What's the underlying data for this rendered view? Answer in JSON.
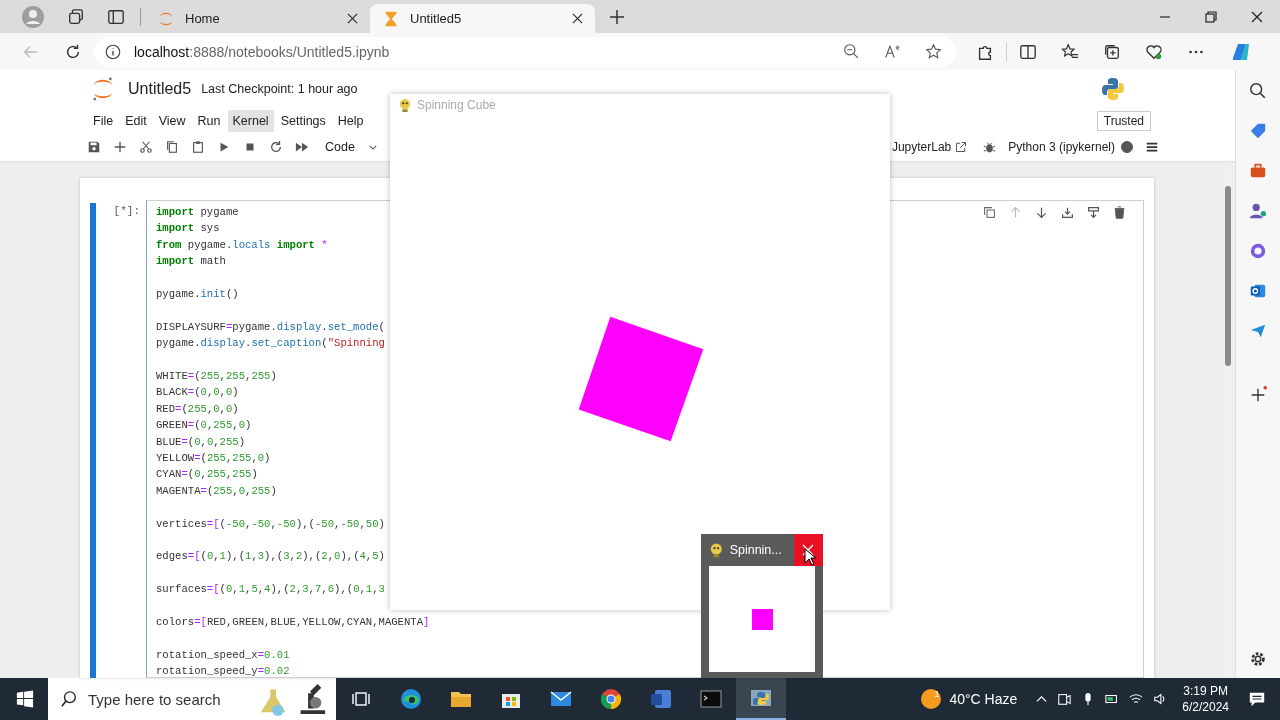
{
  "browser": {
    "tabs": [
      {
        "label": "Home",
        "kind": "jupyter",
        "selected": false
      },
      {
        "label": "Untitled5",
        "kind": "hourglass",
        "selected": true
      }
    ],
    "url_host": "localhost",
    "url_path": ":8888/notebooks/Untitled5.ipynb"
  },
  "notebook": {
    "title": "Untitled5",
    "checkpoint": "Last Checkpoint: 1 hour ago",
    "trusted": "Trusted",
    "menu": [
      {
        "label": "File",
        "selected": false
      },
      {
        "label": "Edit",
        "selected": false
      },
      {
        "label": "View",
        "selected": false
      },
      {
        "label": "Run",
        "selected": false
      },
      {
        "label": "Kernel",
        "selected": true
      },
      {
        "label": "Settings",
        "selected": false
      },
      {
        "label": "Help",
        "selected": false
      }
    ],
    "cell_type": "Code",
    "jupyterlab": "JupyterLab",
    "kernel": "Python 3 (ipykernel)",
    "kernel_busy": true,
    "cell": {
      "prompt": "[*]:",
      "selected": true,
      "lines": [
        {
          "gap_before": false,
          "tokens": [
            {
              "text": "import",
              "kind": "kw"
            },
            {
              "text": " pygame",
              "kind": "txt"
            }
          ]
        },
        {
          "gap_before": false,
          "tokens": [
            {
              "text": "import",
              "kind": "kw"
            },
            {
              "text": " sys",
              "kind": "txt"
            }
          ]
        },
        {
          "gap_before": false,
          "tokens": [
            {
              "text": "from",
              "kind": "kw"
            },
            {
              "text": " pygame.",
              "kind": "txt"
            },
            {
              "text": "locals",
              "kind": "attr"
            },
            {
              "text": " import",
              "kind": "kw"
            },
            {
              "text": " *",
              "kind": "op"
            }
          ]
        },
        {
          "gap_before": false,
          "tokens": [
            {
              "text": "import",
              "kind": "kw"
            },
            {
              "text": " math",
              "kind": "txt"
            }
          ]
        },
        {
          "gap_before": true,
          "tokens": [
            {
              "text": "pygame.",
              "kind": "txt"
            },
            {
              "text": "init",
              "kind": "attr"
            },
            {
              "text": "()",
              "kind": "txt"
            }
          ]
        },
        {
          "gap_before": true,
          "tokens": [
            {
              "text": "DISPLAYSURF",
              "kind": "txt"
            },
            {
              "text": "=",
              "kind": "op"
            },
            {
              "text": "pygame.",
              "kind": "txt"
            },
            {
              "text": "display",
              "kind": "attr"
            },
            {
              "text": ".",
              "kind": "txt"
            },
            {
              "text": "set_mode",
              "kind": "attr"
            },
            {
              "text": "(",
              "kind": "txt"
            }
          ]
        },
        {
          "gap_before": false,
          "tokens": [
            {
              "text": "pygame.",
              "kind": "txt"
            },
            {
              "text": "display",
              "kind": "attr"
            },
            {
              "text": ".",
              "kind": "txt"
            },
            {
              "text": "set_caption",
              "kind": "attr"
            },
            {
              "text": "(",
              "kind": "txt"
            },
            {
              "text": "\"Spinning",
              "kind": "str"
            }
          ]
        },
        {
          "gap_before": true,
          "tokens": [
            {
              "text": "WHITE",
              "kind": "txt"
            },
            {
              "text": "=",
              "kind": "op"
            },
            {
              "text": "(",
              "kind": "txt"
            },
            {
              "text": "255",
              "kind": "num"
            },
            {
              "text": ",",
              "kind": "txt"
            },
            {
              "text": "255",
              "kind": "num"
            },
            {
              "text": ",",
              "kind": "txt"
            },
            {
              "text": "255",
              "kind": "num"
            },
            {
              "text": ")",
              "kind": "txt"
            }
          ]
        },
        {
          "gap_before": false,
          "tokens": [
            {
              "text": "BLACK",
              "kind": "txt"
            },
            {
              "text": "=",
              "kind": "op"
            },
            {
              "text": "(",
              "kind": "txt"
            },
            {
              "text": "0",
              "kind": "num"
            },
            {
              "text": ",",
              "kind": "txt"
            },
            {
              "text": "0",
              "kind": "num"
            },
            {
              "text": ",",
              "kind": "txt"
            },
            {
              "text": "0",
              "kind": "num"
            },
            {
              "text": ")",
              "kind": "txt"
            }
          ]
        },
        {
          "gap_before": false,
          "tokens": [
            {
              "text": "RED",
              "kind": "txt"
            },
            {
              "text": "=",
              "kind": "op"
            },
            {
              "text": "(",
              "kind": "txt"
            },
            {
              "text": "255",
              "kind": "num"
            },
            {
              "text": ",",
              "kind": "txt"
            },
            {
              "text": "0",
              "kind": "num"
            },
            {
              "text": ",",
              "kind": "txt"
            },
            {
              "text": "0",
              "kind": "num"
            },
            {
              "text": ")",
              "kind": "txt"
            }
          ]
        },
        {
          "gap_before": false,
          "tokens": [
            {
              "text": "GREEN",
              "kind": "txt"
            },
            {
              "text": "=",
              "kind": "op"
            },
            {
              "text": "(",
              "kind": "txt"
            },
            {
              "text": "0",
              "kind": "num"
            },
            {
              "text": ",",
              "kind": "txt"
            },
            {
              "text": "255",
              "kind": "num"
            },
            {
              "text": ",",
              "kind": "txt"
            },
            {
              "text": "0",
              "kind": "num"
            },
            {
              "text": ")",
              "kind": "txt"
            }
          ]
        },
        {
          "gap_before": false,
          "tokens": [
            {
              "text": "BLUE",
              "kind": "txt"
            },
            {
              "text": "=",
              "kind": "op"
            },
            {
              "text": "(",
              "kind": "txt"
            },
            {
              "text": "0",
              "kind": "num"
            },
            {
              "text": ",",
              "kind": "txt"
            },
            {
              "text": "0",
              "kind": "num"
            },
            {
              "text": ",",
              "kind": "txt"
            },
            {
              "text": "255",
              "kind": "num"
            },
            {
              "text": ")",
              "kind": "txt"
            }
          ]
        },
        {
          "gap_before": false,
          "tokens": [
            {
              "text": "YELLOW",
              "kind": "txt"
            },
            {
              "text": "=",
              "kind": "op"
            },
            {
              "text": "(",
              "kind": "txt"
            },
            {
              "text": "255",
              "kind": "num"
            },
            {
              "text": ",",
              "kind": "txt"
            },
            {
              "text": "255",
              "kind": "num"
            },
            {
              "text": ",",
              "kind": "txt"
            },
            {
              "text": "0",
              "kind": "num"
            },
            {
              "text": ")",
              "kind": "txt"
            }
          ]
        },
        {
          "gap_before": false,
          "tokens": [
            {
              "text": "CYAN",
              "kind": "txt"
            },
            {
              "text": "=",
              "kind": "op"
            },
            {
              "text": "(",
              "kind": "txt"
            },
            {
              "text": "0",
              "kind": "num"
            },
            {
              "text": ",",
              "kind": "txt"
            },
            {
              "text": "255",
              "kind": "num"
            },
            {
              "text": ",",
              "kind": "txt"
            },
            {
              "text": "255",
              "kind": "num"
            },
            {
              "text": ")",
              "kind": "txt"
            }
          ]
        },
        {
          "gap_before": false,
          "tokens": [
            {
              "text": "MAGENTA",
              "kind": "txt"
            },
            {
              "text": "=",
              "kind": "op"
            },
            {
              "text": "(",
              "kind": "txt"
            },
            {
              "text": "255",
              "kind": "num"
            },
            {
              "text": ",",
              "kind": "txt"
            },
            {
              "text": "0",
              "kind": "num"
            },
            {
              "text": ",",
              "kind": "txt"
            },
            {
              "text": "255",
              "kind": "num"
            },
            {
              "text": ")",
              "kind": "txt"
            }
          ]
        },
        {
          "gap_before": true,
          "tokens": [
            {
              "text": "vertices",
              "kind": "txt"
            },
            {
              "text": "=[",
              "kind": "op"
            },
            {
              "text": "(",
              "kind": "txt"
            },
            {
              "text": "-50",
              "kind": "num"
            },
            {
              "text": ",",
              "kind": "txt"
            },
            {
              "text": "-50",
              "kind": "num"
            },
            {
              "text": ",",
              "kind": "txt"
            },
            {
              "text": "-50",
              "kind": "num"
            },
            {
              "text": "),(",
              "kind": "txt"
            },
            {
              "text": "-50",
              "kind": "num"
            },
            {
              "text": ",",
              "kind": "txt"
            },
            {
              "text": "-50",
              "kind": "num"
            },
            {
              "text": ",",
              "kind": "txt"
            },
            {
              "text": "50",
              "kind": "num"
            },
            {
              "text": ")",
              "kind": "txt"
            }
          ]
        },
        {
          "gap_before": true,
          "tokens": [
            {
              "text": "edges",
              "kind": "txt"
            },
            {
              "text": "=[",
              "kind": "op"
            },
            {
              "text": "(",
              "kind": "txt"
            },
            {
              "text": "0",
              "kind": "num"
            },
            {
              "text": ",",
              "kind": "txt"
            },
            {
              "text": "1",
              "kind": "num"
            },
            {
              "text": "),(",
              "kind": "txt"
            },
            {
              "text": "1",
              "kind": "num"
            },
            {
              "text": ",",
              "kind": "txt"
            },
            {
              "text": "3",
              "kind": "num"
            },
            {
              "text": "),(",
              "kind": "txt"
            },
            {
              "text": "3",
              "kind": "num"
            },
            {
              "text": ",",
              "kind": "txt"
            },
            {
              "text": "2",
              "kind": "num"
            },
            {
              "text": "),(",
              "kind": "txt"
            },
            {
              "text": "2",
              "kind": "num"
            },
            {
              "text": ",",
              "kind": "txt"
            },
            {
              "text": "0",
              "kind": "num"
            },
            {
              "text": "),(",
              "kind": "txt"
            },
            {
              "text": "4",
              "kind": "num"
            },
            {
              "text": ",",
              "kind": "txt"
            },
            {
              "text": "5",
              "kind": "num"
            },
            {
              "text": ")",
              "kind": "txt"
            }
          ]
        },
        {
          "gap_before": true,
          "tokens": [
            {
              "text": "surfaces",
              "kind": "txt"
            },
            {
              "text": "=[",
              "kind": "op"
            },
            {
              "text": "(",
              "kind": "txt"
            },
            {
              "text": "0",
              "kind": "num"
            },
            {
              "text": ",",
              "kind": "txt"
            },
            {
              "text": "1",
              "kind": "num"
            },
            {
              "text": ",",
              "kind": "txt"
            },
            {
              "text": "5",
              "kind": "num"
            },
            {
              "text": ",",
              "kind": "txt"
            },
            {
              "text": "4",
              "kind": "num"
            },
            {
              "text": "),(",
              "kind": "txt"
            },
            {
              "text": "2",
              "kind": "num"
            },
            {
              "text": ",",
              "kind": "txt"
            },
            {
              "text": "3",
              "kind": "num"
            },
            {
              "text": ",",
              "kind": "txt"
            },
            {
              "text": "7",
              "kind": "num"
            },
            {
              "text": ",",
              "kind": "txt"
            },
            {
              "text": "6",
              "kind": "num"
            },
            {
              "text": "),(",
              "kind": "txt"
            },
            {
              "text": "0",
              "kind": "num"
            },
            {
              "text": ",",
              "kind": "txt"
            },
            {
              "text": "1",
              "kind": "num"
            },
            {
              "text": ",",
              "kind": "txt"
            },
            {
              "text": "3",
              "kind": "num"
            }
          ]
        },
        {
          "gap_before": true,
          "tokens": [
            {
              "text": "colors",
              "kind": "txt"
            },
            {
              "text": "=[",
              "kind": "op"
            },
            {
              "text": "RED,GREEN,BLUE,YELLOW,CYAN,MAGENTA",
              "kind": "txt"
            },
            {
              "text": "]",
              "kind": "op"
            }
          ]
        },
        {
          "gap_before": true,
          "tokens": [
            {
              "text": "rotation_speed_x",
              "kind": "txt"
            },
            {
              "text": "=",
              "kind": "op"
            },
            {
              "text": "0.01",
              "kind": "num"
            }
          ]
        },
        {
          "gap_before": false,
          "tokens": [
            {
              "text": "rotation_speed_y",
              "kind": "txt"
            },
            {
              "text": "=",
              "kind": "op"
            },
            {
              "text": "0.02",
              "kind": "num"
            }
          ]
        }
      ]
    }
  },
  "pygame_window": {
    "title": "Spinning Cube"
  },
  "preview": {
    "title": "Spinnin..."
  },
  "taskbar": {
    "search_placeholder": "Type here to search",
    "apps": [
      {
        "kind": "taskview",
        "selected": false
      },
      {
        "kind": "edge",
        "selected": false
      },
      {
        "kind": "explorer",
        "selected": false
      },
      {
        "kind": "store",
        "selected": false
      },
      {
        "kind": "mail",
        "selected": false
      },
      {
        "kind": "chrome",
        "selected": false
      },
      {
        "kind": "word",
        "selected": false
      },
      {
        "kind": "terminal",
        "selected": false
      },
      {
        "kind": "python",
        "selected": true
      }
    ],
    "weather": "40°C Haze",
    "weather_badge": "1",
    "time": "3:19 PM",
    "date": "6/2/2024"
  }
}
